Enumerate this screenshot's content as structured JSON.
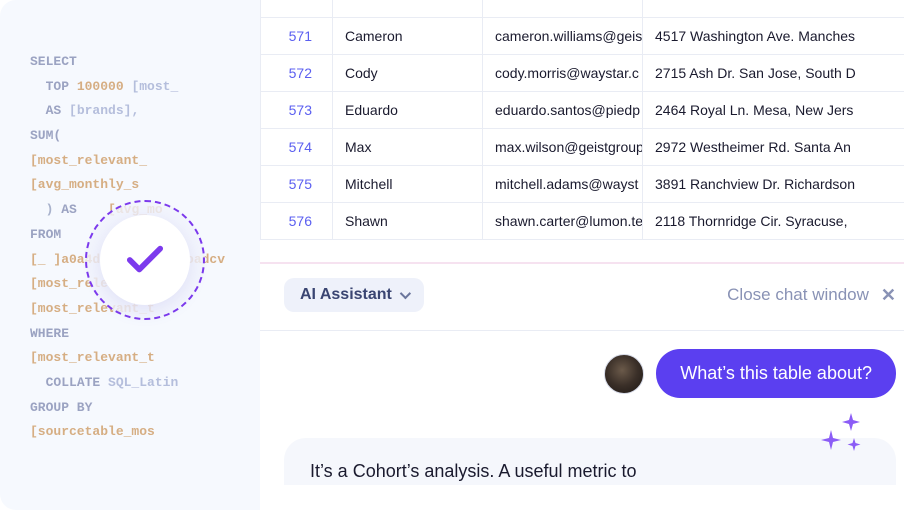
{
  "sql": {
    "lines": [
      {
        "text": "SELECT",
        "cls": "kw"
      },
      {
        "text": "  TOP 100000 [most_",
        "cls": "mix1"
      },
      {
        "text": "  AS [brands],",
        "cls": "mix2"
      },
      {
        "text": "  SUM(",
        "cls": "kw"
      },
      {
        "text": "    [most_relevant_",
        "cls": "highlight"
      },
      {
        "text": "    [avg_monthly_s",
        "cls": "highlight"
      },
      {
        "text": "  ) AS     [avg_mo",
        "cls": "mix3"
      },
      {
        "text": "FROM",
        "cls": "kw"
      },
      {
        "text": "  [_         ]a0a4d793cb41d_eooadcv",
        "cls": "highlight"
      },
      {
        "text": "  [most_relevant_t",
        "cls": "highlight"
      },
      {
        "text": "  [most_relevant_t",
        "cls": "highlight"
      },
      {
        "text": "WHERE",
        "cls": "kw"
      },
      {
        "text": "  [most_relevant_t",
        "cls": "highlight"
      },
      {
        "text": "  COLLATE SQL_Latin",
        "cls": "mix4"
      },
      {
        "text": "GROUP BY",
        "cls": "kw"
      },
      {
        "text": "  [sourcetable_mos",
        "cls": "highlight"
      }
    ]
  },
  "table": {
    "rows": [
      {
        "idx": "571",
        "name": "Cameron",
        "email": "cameron.williams@geis",
        "addr": "4517 Washington Ave. Manches"
      },
      {
        "idx": "572",
        "name": "Cody",
        "email": "cody.morris@waystar.c",
        "addr": "2715 Ash Dr. San Jose, South D"
      },
      {
        "idx": "573",
        "name": "Eduardo",
        "email": "eduardo.santos@piedp",
        "addr": "2464 Royal Ln. Mesa, New Jers"
      },
      {
        "idx": "574",
        "name": "Max",
        "email": "max.wilson@geistgroup",
        "addr": "2972 Westheimer Rd. Santa An"
      },
      {
        "idx": "575",
        "name": "Mitchell",
        "email": "mitchell.adams@wayst",
        "addr": "3891 Ranchview Dr. Richardson"
      },
      {
        "idx": "576",
        "name": "Shawn",
        "email": "shawn.carter@lumon.te",
        "addr": "2118 Thornridge Cir. Syracuse,"
      }
    ]
  },
  "chat": {
    "assistant_label": "AI Assistant",
    "close_label": "Close chat window",
    "user_message": "What’s this table about?",
    "ai_response": "It’s a Cohort’s analysis. A useful metric to"
  }
}
